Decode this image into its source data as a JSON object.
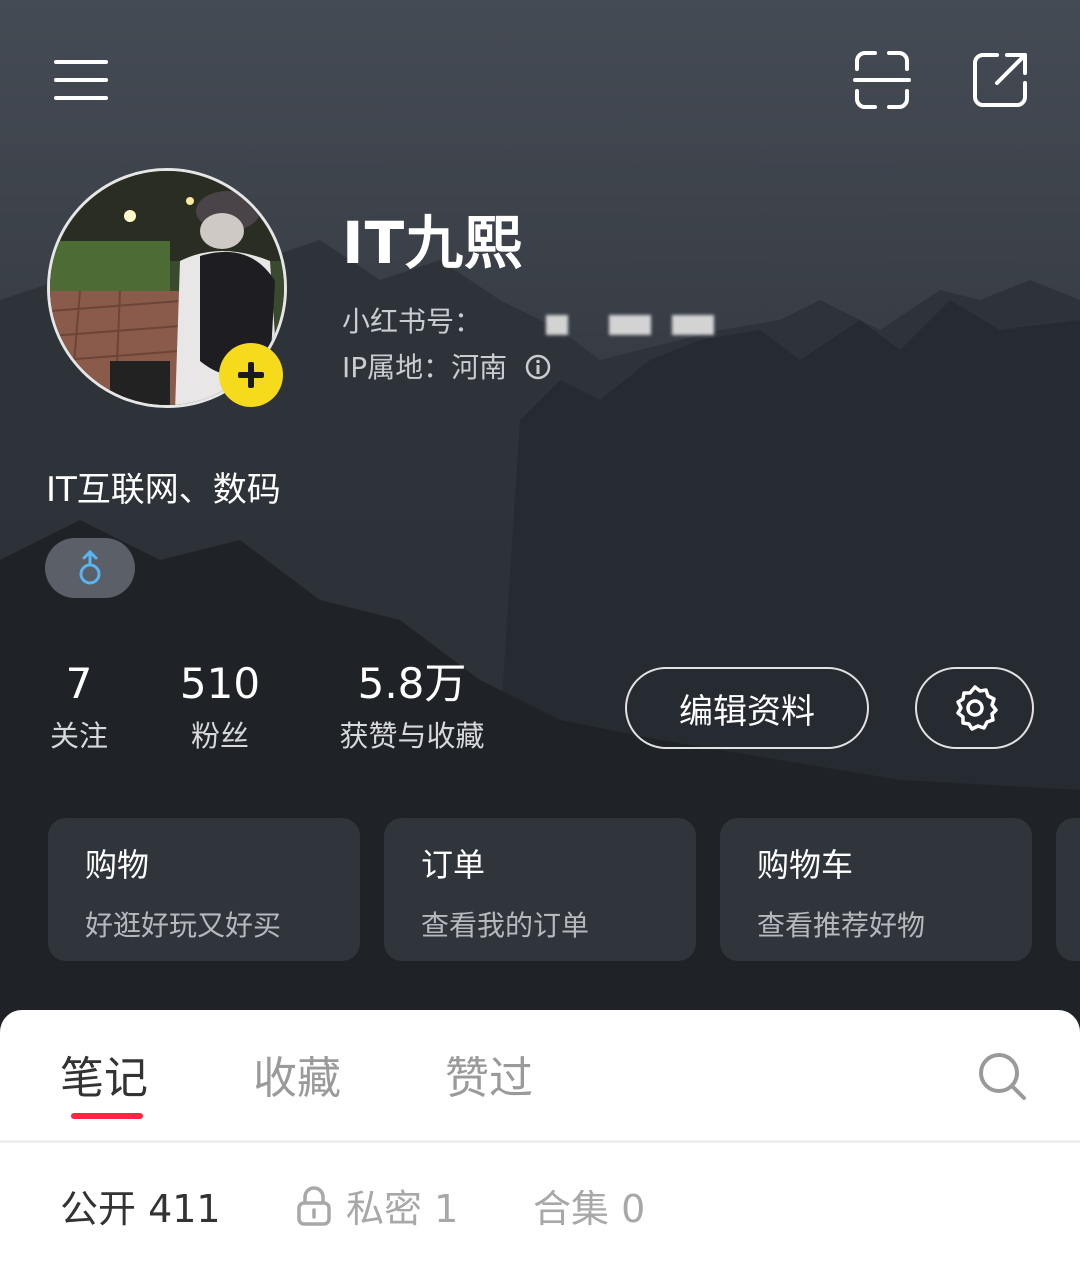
{
  "header": {
    "menu_icon": "hamburger-menu-icon",
    "scan_icon": "scan-icon",
    "share_icon": "share-icon"
  },
  "profile": {
    "username": "IT九熙",
    "id_label": "小红书号：",
    "ip_label": "IP属地：河南",
    "bio": "IT互联网、数码",
    "gender_icon": "male-icon",
    "avatar_badge_icon": "plus-icon"
  },
  "stats": [
    {
      "value": "7",
      "label": "关注"
    },
    {
      "value": "510",
      "label": "粉丝"
    },
    {
      "value": "5.8万",
      "label": "获赞与收藏"
    }
  ],
  "actions": {
    "edit_label": "编辑资料",
    "settings_icon": "gear-icon"
  },
  "cards": [
    {
      "title": "购物",
      "subtitle": "好逛好玩又好买"
    },
    {
      "title": "订单",
      "subtitle": "查看我的订单"
    },
    {
      "title": "购物车",
      "subtitle": "查看推荐好物"
    }
  ],
  "tabs": [
    "笔记",
    "收藏",
    "赞过"
  ],
  "active_tab": "笔记",
  "subtabs": [
    {
      "label": "公开 411"
    },
    {
      "label": "私密 1",
      "icon": "lock-icon"
    },
    {
      "label": "合集 0"
    }
  ],
  "colors": {
    "accent": "#ff2442",
    "badge": "#f6da1c",
    "gender": "#5ab4f0"
  }
}
